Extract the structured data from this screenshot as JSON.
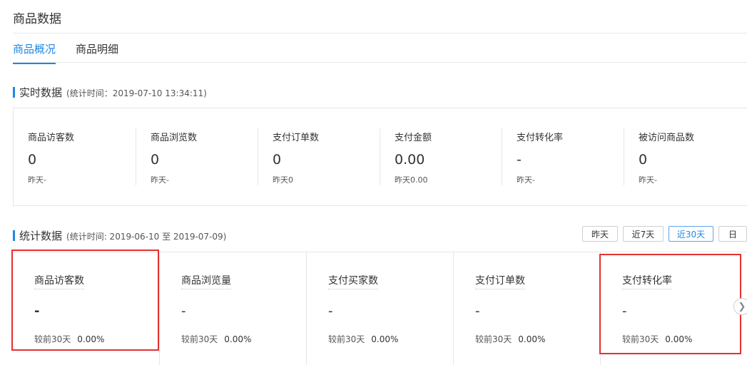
{
  "page_title": "商品数据",
  "tabs": [
    {
      "label": "商品概况",
      "active": true
    },
    {
      "label": "商品明细",
      "active": false
    }
  ],
  "realtime": {
    "title": "实时数据",
    "subtitle": "(统计时间：2019-07-10 13:34:11)",
    "metrics": [
      {
        "label": "商品访客数",
        "value": "0",
        "compare": "昨天-"
      },
      {
        "label": "商品浏览数",
        "value": "0",
        "compare": "昨天-"
      },
      {
        "label": "支付订单数",
        "value": "0",
        "compare": "昨天0"
      },
      {
        "label": "支付金额",
        "value": "0.00",
        "compare": "昨天0.00"
      },
      {
        "label": "支付转化率",
        "value": "-",
        "compare": "昨天-"
      },
      {
        "label": "被访问商品数",
        "value": "0",
        "compare": "昨天-"
      }
    ]
  },
  "statistics": {
    "title": "统计数据",
    "subtitle": "(统计时间: 2019-06-10 至 2019-07-09)",
    "ranges": [
      {
        "label": "昨天",
        "active": false
      },
      {
        "label": "近7天",
        "active": false
      },
      {
        "label": "近30天",
        "active": true
      },
      {
        "label": "日",
        "active": false
      }
    ],
    "cards": [
      {
        "label": "商品访客数",
        "value": "-",
        "compare_label": "较前30天",
        "compare_value": "0.00%"
      },
      {
        "label": "商品浏览量",
        "value": "-",
        "compare_label": "较前30天",
        "compare_value": "0.00%"
      },
      {
        "label": "支付买家数",
        "value": "-",
        "compare_label": "较前30天",
        "compare_value": "0.00%"
      },
      {
        "label": "支付订单数",
        "value": "-",
        "compare_label": "较前30天",
        "compare_value": "0.00%"
      },
      {
        "label": "支付转化率",
        "value": "-",
        "compare_label": "较前30天",
        "compare_value": "0.00%"
      }
    ]
  },
  "icons": {
    "next_arrow": "chevron-right-icon"
  },
  "colors": {
    "accent": "#1e88e5",
    "highlight": "#e53030"
  }
}
